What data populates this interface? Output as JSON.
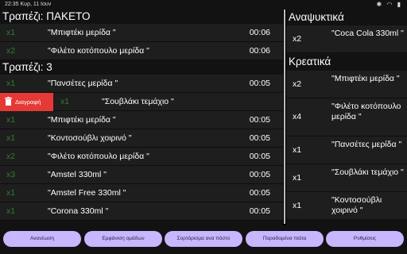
{
  "status_bar": {
    "time": "22:35 Κυρ, 11 Ιουν",
    "icons": [
      "bluetooth-icon",
      "wifi-icon",
      "battery-icon"
    ]
  },
  "left_panel": {
    "sections": [
      {
        "title": "Τραπέζι: ΠΑΚΕΤΟ",
        "rows": [
          {
            "qty": "x1",
            "name": "\"Μπιφτέκι μερίδα \"",
            "time": "00:06"
          },
          {
            "qty": "x2",
            "name": "\"Φιλέτο κοτόπουλο μερίδα \"",
            "time": "00:06"
          }
        ]
      },
      {
        "title": "Τραπέζι: 3",
        "rows": [
          {
            "qty": "x1",
            "name": "\"Πανσέτες μερίδα \"",
            "time": "00:05"
          },
          {
            "qty": "x1",
            "name": "\"Σουβλάκι τεμάχιο \"",
            "time": "",
            "swiped": true,
            "delete_label": "Διαγραφή"
          },
          {
            "qty": "x1",
            "name": "\"Μπιφτέκι μερίδα \"",
            "time": "00:05"
          },
          {
            "qty": "x1",
            "name": "\"Κοντοσούβλι χοιρινό \"",
            "time": "00:05"
          },
          {
            "qty": "x2",
            "name": "\"Φιλέτο κοτόπουλο μερίδα \"",
            "time": "00:05"
          },
          {
            "qty": "x3",
            "name": "\"Amstel 330ml \"",
            "time": "00:05"
          },
          {
            "qty": "x1",
            "name": "\"Amstel Free 330ml \"",
            "time": "00:05"
          },
          {
            "qty": "x1",
            "name": "\"Corona 330ml \"",
            "time": "00:05"
          }
        ]
      }
    ]
  },
  "right_panel": {
    "sections": [
      {
        "title": "Αναψυκτικά",
        "rows": [
          {
            "qty": "x2",
            "name": "\"Coca Cola 330ml \""
          }
        ]
      },
      {
        "title": "Κρεατικά",
        "rows": [
          {
            "qty": "x2",
            "name": "\"Μπιφτέκι μερίδα \""
          },
          {
            "qty": "x4",
            "name": "\"Φιλέτο κοτόπουλο μερίδα \""
          },
          {
            "qty": "x1",
            "name": "\"Πανσέτες μερίδα \""
          },
          {
            "qty": "x1",
            "name": "\"Σουβλάκι τεμάχιο \""
          },
          {
            "qty": "x1",
            "name": "\"Κοντοσούβλι χοιρινό \""
          }
        ]
      }
    ]
  },
  "bottom_bar": {
    "buttons": [
      "Ανανέωση",
      "Εμφάνιση ομάδων",
      "Σορτάρισμα ανα πόστο",
      "Παραδομένα πιάτα",
      "Ρυθμίσεις"
    ]
  },
  "colors": {
    "qty_green": "#2e7d32",
    "button_bg": "#c8b6ff",
    "delete_red": "#e53935"
  }
}
